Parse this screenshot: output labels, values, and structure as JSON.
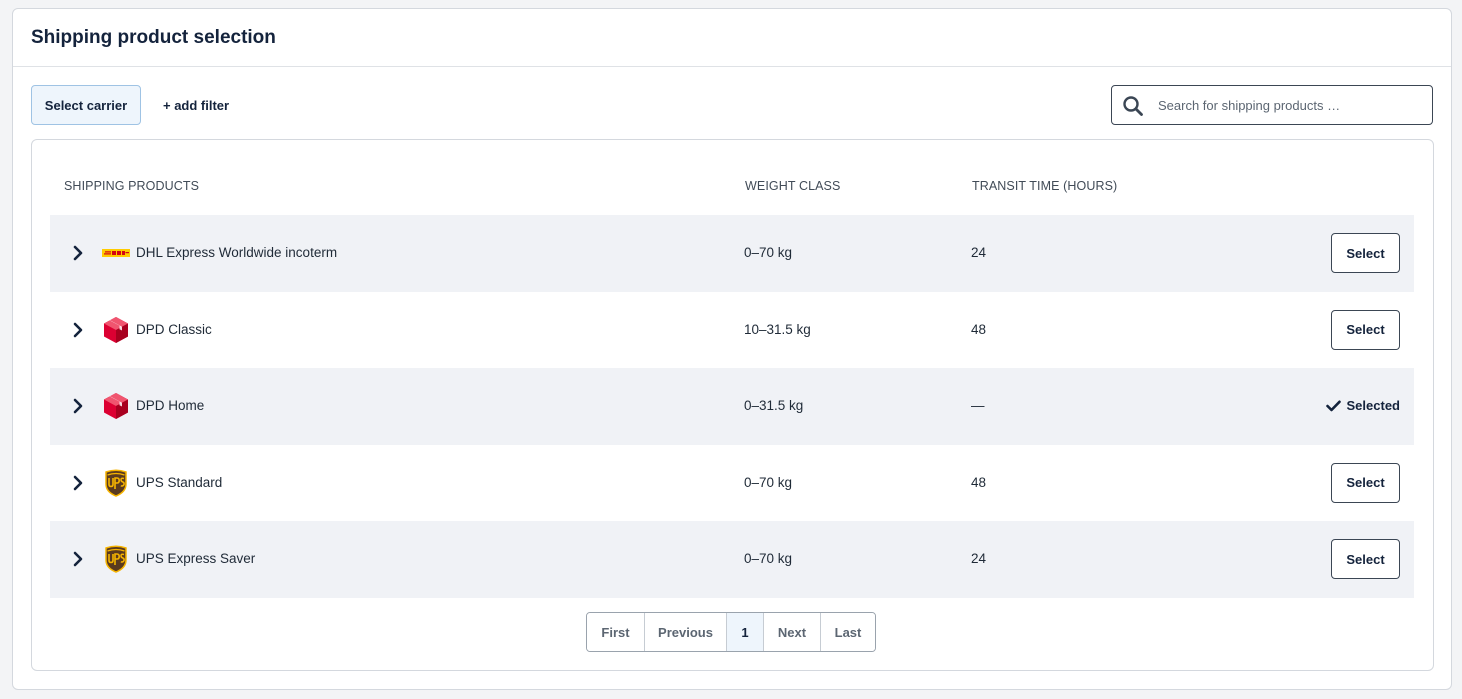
{
  "header": {
    "title": "Shipping product selection"
  },
  "toolbar": {
    "carrier_button": "Select carrier",
    "add_filter": "+ add filter",
    "search_placeholder": "Search for shipping products …",
    "search_value": ""
  },
  "table": {
    "columns": [
      "SHIPPING PRODUCTS",
      "WEIGHT CLASS",
      "TRANSIT TIME (HOURS)"
    ],
    "rows": [
      {
        "carrier": "dhl",
        "carrier_icon": "dhl-logo-icon",
        "name": "DHL Express Worldwide incoterm",
        "weight": "0–70 kg",
        "transit": "24",
        "action": "Select",
        "selected": false
      },
      {
        "carrier": "dpd",
        "carrier_icon": "dpd-logo-icon",
        "name": "DPD Classic",
        "weight": "10–31.5 kg",
        "transit": "48",
        "action": "Select",
        "selected": false
      },
      {
        "carrier": "dpd",
        "carrier_icon": "dpd-logo-icon",
        "name": "DPD Home",
        "weight": "0–31.5 kg",
        "transit": "—",
        "action": "Selected",
        "selected": true
      },
      {
        "carrier": "ups",
        "carrier_icon": "ups-logo-icon",
        "name": "UPS Standard",
        "weight": "0–70 kg",
        "transit": "48",
        "action": "Select",
        "selected": false
      },
      {
        "carrier": "ups",
        "carrier_icon": "ups-logo-icon",
        "name": "UPS Express Saver",
        "weight": "0–70 kg",
        "transit": "24",
        "action": "Select",
        "selected": false
      }
    ]
  },
  "pagination": {
    "first": "First",
    "previous": "Previous",
    "current_page": "1",
    "next": "Next",
    "last": "Last"
  },
  "colors": {
    "accent_light": "#eef5fc",
    "row_shade": "#f0f2f6",
    "dpd_red": "#dc0032",
    "ups_brown": "#5a3a1e",
    "ups_gold": "#f6b400",
    "dhl_yellow": "#ffcc00",
    "dhl_red": "#d40511"
  }
}
